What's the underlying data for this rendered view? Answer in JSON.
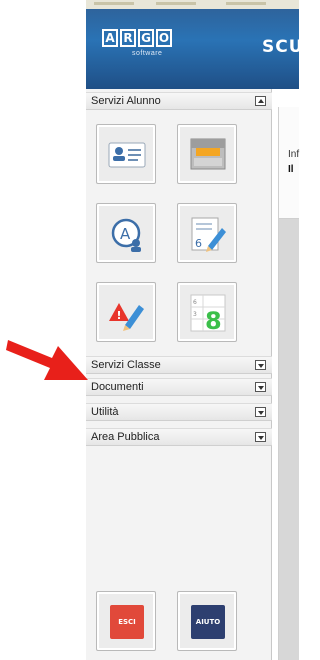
{
  "header": {
    "logo_letters": [
      "A",
      "R",
      "G",
      "O"
    ],
    "logo_sub": "software",
    "title": "SCU"
  },
  "sidebar": {
    "sections": [
      {
        "label": "Servizi Alunno",
        "state": "expanded"
      },
      {
        "label": "Servizi Classe",
        "state": "collapsed"
      },
      {
        "label": "Documenti",
        "state": "collapsed"
      },
      {
        "label": "Utilità",
        "state": "collapsed"
      },
      {
        "label": "Area Pubblica",
        "state": "collapsed"
      }
    ],
    "tiles": [
      {
        "icon": "student-card-icon"
      },
      {
        "icon": "archive-drawer-icon"
      },
      {
        "icon": "absence-user-icon"
      },
      {
        "icon": "grades-notebook-icon"
      },
      {
        "icon": "disciplinary-note-icon"
      },
      {
        "icon": "timetable-calendar-icon"
      }
    ],
    "bottom_buttons": [
      {
        "label": "ESCI",
        "color": "#e1493a"
      },
      {
        "label": "AIUTO",
        "color": "#2d3f70"
      }
    ]
  },
  "content": {
    "line1": "Inf",
    "line2": "Il"
  },
  "colors": {
    "banner": "#2a73b5",
    "arrow": "#e8201a"
  }
}
